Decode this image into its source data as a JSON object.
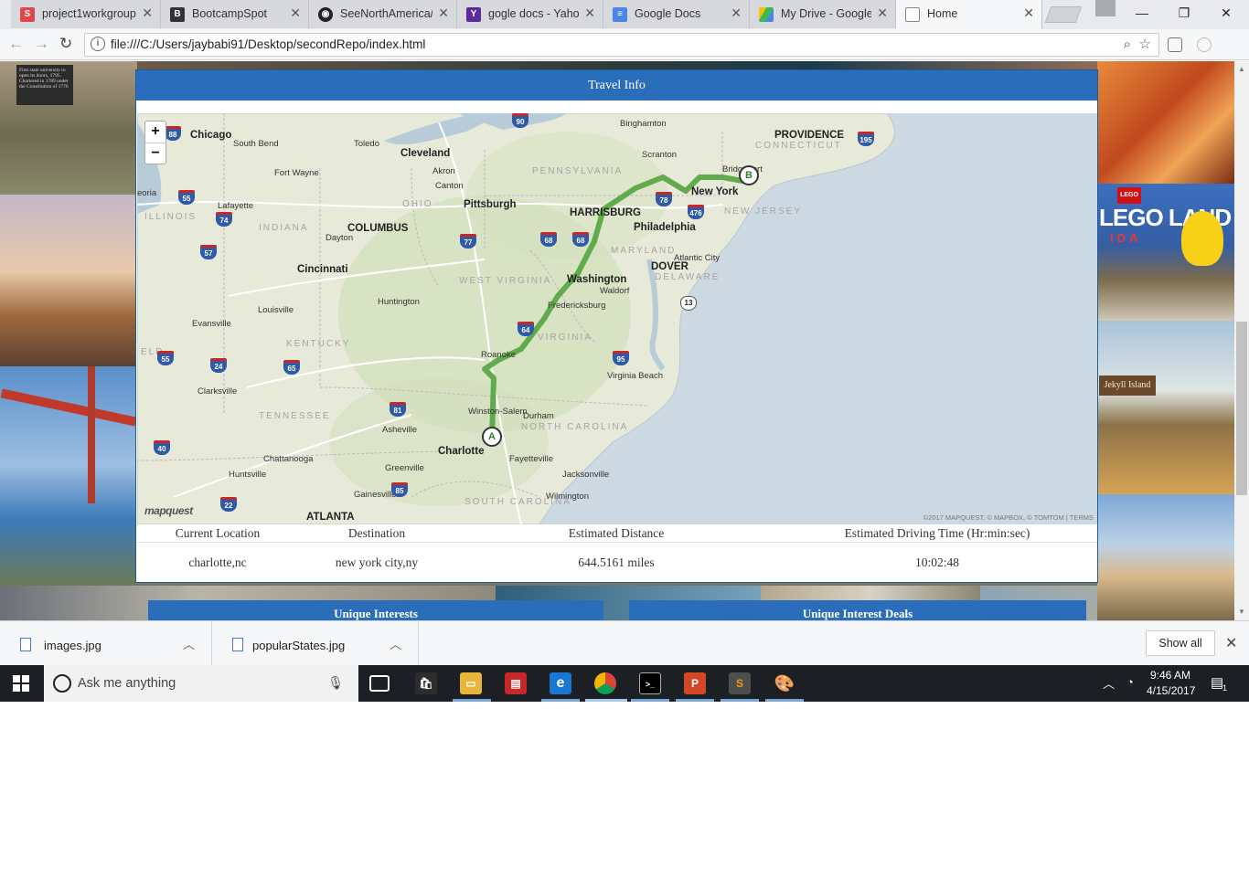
{
  "tabs": [
    {
      "label": "project1workgroup",
      "icon": "slack-icon"
    },
    {
      "label": "BootcampSpot",
      "icon": "bootcampspot-icon"
    },
    {
      "label": "SeeNorthAmerica/",
      "icon": "github-icon"
    },
    {
      "label": "gogle docs - Yaho",
      "icon": "yahoo-icon"
    },
    {
      "label": "Google Docs",
      "icon": "google-docs-icon"
    },
    {
      "label": "My Drive - Google",
      "icon": "google-drive-icon"
    },
    {
      "label": "Home",
      "icon": "page-icon"
    }
  ],
  "address": {
    "url": "file:///C:/Users/jaybabi91/Desktop/secondRepo/index.html"
  },
  "modal": {
    "title": "Travel Info",
    "map": {
      "zoom_in": "+",
      "zoom_out": "−",
      "logo": "mapquest",
      "credit": "©2017 MAPQUEST, © MAPBOX, © TOMTOM | TERMS",
      "start_marker": "A",
      "end_marker": "B",
      "labels": [
        "Chicago",
        "South Bend",
        "Toledo",
        "Cleveland",
        "Binghamton",
        "PROVIDENCE",
        "CONNECTICUT",
        "Scranton",
        "Bridgeport",
        "New York",
        "Fort Wayne",
        "Akron",
        "PENNSYLVANIA",
        "Canton",
        "OHIO",
        "Pittsburgh",
        "HARRISBURG",
        "Philadelphia",
        "NEW JERSEY",
        "Lafayette",
        "ILLINOIS",
        "INDIANA",
        "COLUMBUS",
        "Dayton",
        "MARYLAND",
        "Atlantic City",
        "DOVER",
        "DELAWARE",
        "Cincinnati",
        "Washington",
        "Waldorf",
        "WEST VIRGINIA",
        "Huntington",
        "Fredericksburg",
        "Louisville",
        "Evansville",
        "KENTUCKY",
        "VIRGINIA",
        "Roanoke",
        "Virginia Beach",
        "Clarksville",
        "TENNESSEE",
        "Winston-Salem",
        "Durham",
        "NORTH CAROLINA",
        "Asheville",
        "Charlotte",
        "Fayetteville",
        "Chattanooga",
        "Greenville",
        "Jacksonville",
        "Huntsville",
        "Gainesville",
        "Wilmington",
        "SOUTH CAROLINA",
        "ATLANTA",
        "ELD",
        "eoria"
      ],
      "shields": [
        "90",
        "88",
        "195",
        "55",
        "74",
        "57",
        "77",
        "68",
        "68",
        "78",
        "476",
        "13",
        "64",
        "95",
        "55",
        "24",
        "65",
        "81",
        "40",
        "85",
        "22"
      ]
    },
    "table": {
      "headers": [
        "Current Location",
        "Destination",
        "Estimated Distance",
        "Estimated Driving Time (Hr:min:sec)"
      ],
      "row": [
        "charlotte,nc",
        "new york city,ny",
        "644.5161 miles",
        "10:02:48"
      ]
    }
  },
  "lower": {
    "left_title": "Unique Interests",
    "right_title": "Unique Interest Deals"
  },
  "backgrounds": {
    "left_top_caption": "First state university to open its doors, 1795. Chartered in 1789 under the Constitution of 1776",
    "lego_text": "LEGO LAND",
    "lego_sub": "IDA",
    "jekyll_sign": "Jekyll Island"
  },
  "downloads": {
    "items": [
      {
        "name": "images.jpg"
      },
      {
        "name": "popularStates.jpg"
      }
    ],
    "show_all": "Show all"
  },
  "taskbar": {
    "search_placeholder": "Ask me anything",
    "time": "9:46 AM",
    "date": "4/15/2017",
    "notification_count": "1"
  },
  "colors": {
    "accent": "#2a6ebb",
    "route": "#5aa845",
    "taskbar": "#1c1f24"
  }
}
